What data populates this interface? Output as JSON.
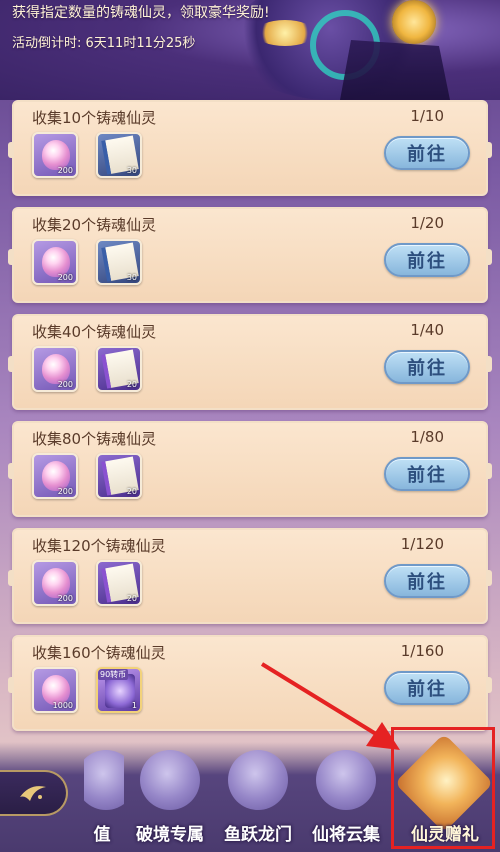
{
  "banner": {
    "title": "获得指定数量的铸魂仙灵，领取豪华奖励!",
    "timer": "活动倒计时:  6天11时11分25秒"
  },
  "tasks": [
    {
      "title": "收集10个铸魂仙灵",
      "progress": "1/10",
      "button": "前往",
      "rewards": [
        {
          "icon": "soul-gem-icon",
          "qty": "200"
        },
        {
          "icon": "blue-scroll-icon",
          "qty": "30"
        }
      ]
    },
    {
      "title": "收集20个铸魂仙灵",
      "progress": "1/20",
      "button": "前往",
      "rewards": [
        {
          "icon": "soul-gem-icon",
          "qty": "200"
        },
        {
          "icon": "blue-scroll-icon",
          "qty": "30"
        }
      ]
    },
    {
      "title": "收集40个铸魂仙灵",
      "progress": "1/40",
      "button": "前往",
      "rewards": [
        {
          "icon": "soul-gem-icon",
          "qty": "200"
        },
        {
          "icon": "purple-scroll-icon",
          "qty": "20"
        }
      ]
    },
    {
      "title": "收集80个铸魂仙灵",
      "progress": "1/80",
      "button": "前往",
      "rewards": [
        {
          "icon": "soul-gem-icon",
          "qty": "200"
        },
        {
          "icon": "purple-scroll-icon",
          "qty": "20"
        }
      ]
    },
    {
      "title": "收集120个铸魂仙灵",
      "progress": "1/120",
      "button": "前往",
      "rewards": [
        {
          "icon": "soul-gem-icon",
          "qty": "200"
        },
        {
          "icon": "purple-scroll-icon",
          "qty": "20"
        }
      ]
    },
    {
      "title": "收集160个铸魂仙灵",
      "progress": "1/160",
      "button": "前往",
      "rewards": [
        {
          "icon": "soul-gem-icon",
          "qty": "1000"
        },
        {
          "icon": "card-90-icon",
          "qty": "1",
          "badge": "90转币"
        }
      ]
    }
  ],
  "bottom_nav": {
    "items": [
      {
        "label": "值",
        "partial": true
      },
      {
        "label": "破境专属"
      },
      {
        "label": "鱼跃龙门"
      },
      {
        "label": "仙将云集"
      },
      {
        "label": "仙灵赠礼",
        "active": true
      }
    ]
  },
  "colors": {
    "highlight": "#e52222",
    "button": "#87b6dc",
    "card": "#f4d6b7"
  }
}
